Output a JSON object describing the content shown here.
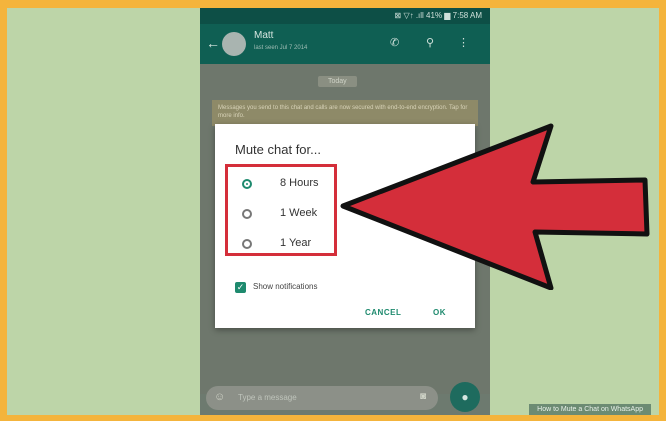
{
  "status_bar": {
    "text": "⊠ ▽↑ .ıll 41% ▆ 7:58 AM"
  },
  "app_bar": {
    "back": "←",
    "contact_name": "Matt",
    "last_seen": "last seen Jul 7 2014",
    "call_icon": "call-icon",
    "attach_icon": "attach-icon",
    "menu_icon": "more-icon"
  },
  "chat": {
    "date_pill": "Today",
    "notice": "Messages you send to this chat and calls are now secured with end-to-end encryption. Tap for more info."
  },
  "dialog": {
    "title": "Mute chat for...",
    "options": [
      {
        "label": "8 Hours",
        "checked": true
      },
      {
        "label": "1 Week",
        "checked": false
      },
      {
        "label": "1 Year",
        "checked": false
      }
    ],
    "show_notifications_label": "Show notifications",
    "show_notifications_checked": true,
    "cancel_label": "CANCEL",
    "ok_label": "OK"
  },
  "composer": {
    "placeholder": "Type a message"
  },
  "colors": {
    "accent": "#1e8a6e",
    "highlight": "#d42e3a",
    "app_bar": "#0f5f53"
  },
  "watermark": "How to Mute a Chat on WhatsApp"
}
